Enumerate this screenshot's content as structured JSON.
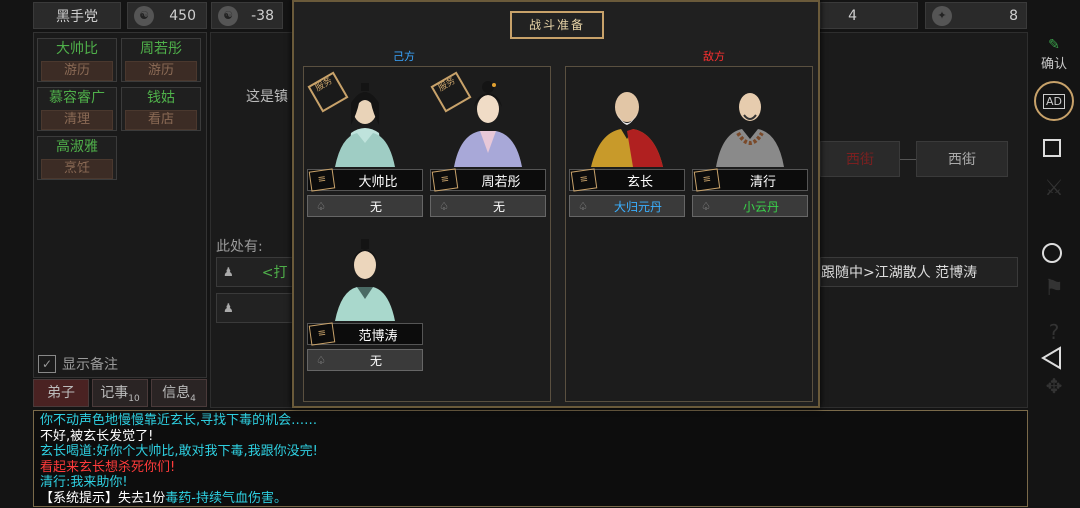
{
  "top_bar": {
    "sect_name": "黑手党",
    "stat1": "450",
    "stat2": "-38",
    "stat3": "4",
    "stat4": "8"
  },
  "roster": [
    {
      "name": "大帅比",
      "status": "游历",
      "name_color": "#4fb04a"
    },
    {
      "name": "周若彤",
      "status": "游历",
      "name_color": "#4fb04a"
    },
    {
      "name": "慕容睿广",
      "status": "清理",
      "name_color": "#4fb04a"
    },
    {
      "name": "钱姑",
      "status": "看店",
      "name_color": "#4fb04a"
    },
    {
      "name": "高淑雅",
      "status": "烹饪",
      "name_color": "#4fb04a"
    }
  ],
  "left_panel": {
    "show_notes": "显示备注",
    "tabs": [
      {
        "label": "弟子",
        "badge": ""
      },
      {
        "label": "记事",
        "badge": "10"
      },
      {
        "label": "信息",
        "badge": "4"
      }
    ]
  },
  "background_scene": {
    "location_text": "这是镇",
    "here_label": "此处有:",
    "row1_text": "<打",
    "street_east": "西街",
    "street_west": "西街",
    "follow_text": "跟随中>江湖散人 范博涛"
  },
  "modal": {
    "title": "战斗准备",
    "our_side_label": "己方",
    "enemy_side_label": "敌方",
    "our_side": [
      {
        "name": "大帅比",
        "item": "无",
        "item_color": "#ffffff",
        "badge": "服务"
      },
      {
        "name": "周若彤",
        "item": "无",
        "item_color": "#ffffff",
        "badge": "服务"
      },
      {
        "name": "范博涛",
        "item": "无",
        "item_color": "#ffffff",
        "badge": ""
      }
    ],
    "enemy_side": [
      {
        "name": "玄长",
        "item": "大归元丹",
        "item_color": "#3ab0ff"
      },
      {
        "name": "清行",
        "item": "小云丹",
        "item_color": "#39d24a"
      }
    ]
  },
  "log": [
    {
      "text": "你不动声色地慢慢靠近玄长,寻找下毒的机会……",
      "color": "#2ecfe0"
    },
    {
      "text": "不好,被玄长发觉了!",
      "color": "#ffffff"
    },
    {
      "text": "玄长喝道:好你个大帅比,敢对我下毒,我跟你没完!",
      "color": "#2ecfe0"
    },
    {
      "text": "看起来玄长想杀死你们!",
      "color": "#ff3b3b"
    },
    {
      "text": "清行:我来助你!",
      "color": "#2ecfe0"
    }
  ],
  "log_last": {
    "prefix": "【系统提示】失去1份",
    "item": "毒药",
    "suffix": "-持续气血伤害。",
    "item_color": "#2ecfe0"
  },
  "right_side": {
    "confirm_label": "确认",
    "ad_label": "AD"
  }
}
